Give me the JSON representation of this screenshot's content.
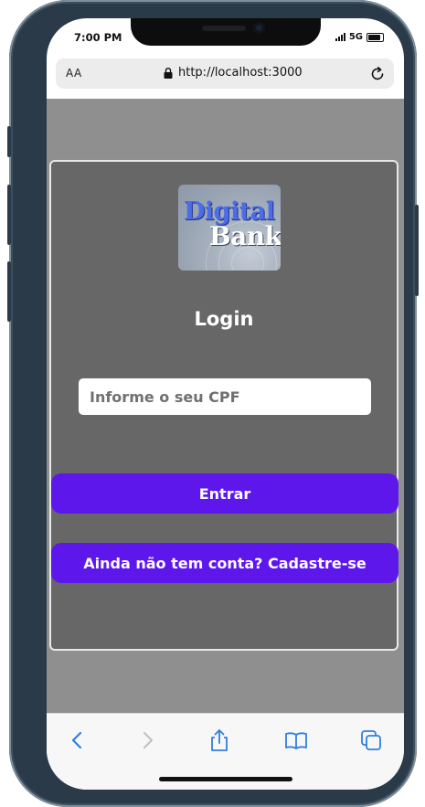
{
  "status_bar": {
    "time": "7:00 PM",
    "network": "5G"
  },
  "browser": {
    "text_size_label": "AA",
    "url": "http://localhost:3000"
  },
  "logo": {
    "line1": "Digital",
    "line2": "Bank"
  },
  "login": {
    "title": "Login",
    "cpf_placeholder": "Informe o seu CPF",
    "cpf_value": "",
    "submit_label": "Entrar",
    "register_label": "Ainda não tem conta? Cadastre-se"
  },
  "colors": {
    "page_background": "#8f8f8f",
    "card_background": "#676767",
    "button": "#5e17eb",
    "toolbar_icon": "#2f7fe0"
  },
  "toolbar": {
    "icons": [
      "back-icon",
      "forward-icon",
      "share-icon",
      "bookmarks-icon",
      "tabs-icon"
    ]
  }
}
